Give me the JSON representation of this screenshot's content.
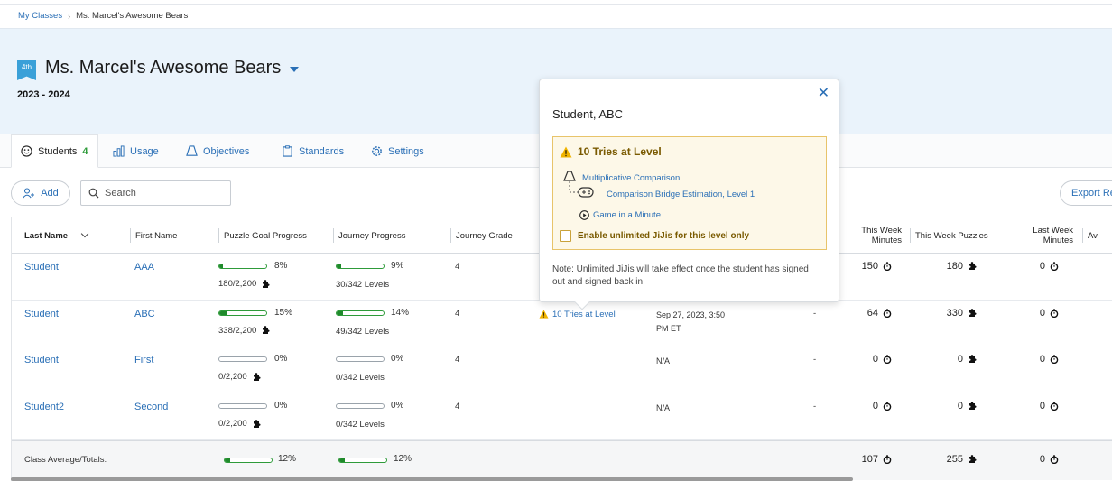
{
  "breadcrumb": {
    "root": "My Classes",
    "current": "Ms. Marcel's Awesome Bears"
  },
  "class": {
    "grade": "4th",
    "title": "Ms. Marcel's Awesome Bears",
    "year": "2023 - 2024"
  },
  "tabs": [
    {
      "label": "Students",
      "count": "4"
    },
    {
      "label": "Usage"
    },
    {
      "label": "Objectives"
    },
    {
      "label": "Standards"
    },
    {
      "label": "Settings"
    }
  ],
  "toolbar": {
    "add_label": "Add",
    "search_placeholder": "Search",
    "export_label": "Export Re"
  },
  "columns": {
    "last_name": "Last Name",
    "first_name": "First Name",
    "puzzle_goal": "Puzzle Goal Progress",
    "journey": "Journey Progress",
    "journey_grade": "Journey Grade",
    "week_minutes_1": "This Week",
    "week_minutes_2": "Minutes",
    "week_puzzles": "This Week Puzzles",
    "last_week_1": "Last Week",
    "last_week_2": "Minutes",
    "avg_partial": "Av"
  },
  "rows": [
    {
      "last": "Student",
      "first": "AAA",
      "puzzle_pct": "8%",
      "puzzle_progress": 0.08,
      "puzzle_count": "180/2,200",
      "journey_pct": "9%",
      "journey_progress": 0.09,
      "journey_levels": "30/342 Levels",
      "grade": "4",
      "alert": "",
      "last_played_1": "",
      "last_played_2": "",
      "dash": "",
      "week_minutes": "150",
      "week_puzzles": "180",
      "last_week_minutes": "0"
    },
    {
      "last": "Student",
      "first": "ABC",
      "puzzle_pct": "15%",
      "puzzle_progress": 0.15,
      "puzzle_count": "338/2,200",
      "journey_pct": "14%",
      "journey_progress": 0.14,
      "journey_levels": "49/342 Levels",
      "grade": "4",
      "alert": "10 Tries at Level",
      "last_played_1": "Sep 27, 2023, 3:50",
      "last_played_2": "PM ET",
      "dash": "-",
      "week_minutes": "64",
      "week_puzzles": "330",
      "last_week_minutes": "0"
    },
    {
      "last": "Student",
      "first": "First",
      "puzzle_pct": "0%",
      "puzzle_progress": 0,
      "puzzle_count": "0/2,200",
      "journey_pct": "0%",
      "journey_progress": 0,
      "journey_levels": "0/342 Levels",
      "grade": "4",
      "alert": "",
      "last_played_1": "N/A",
      "last_played_2": "",
      "dash": "-",
      "week_minutes": "0",
      "week_puzzles": "0",
      "last_week_minutes": "0"
    },
    {
      "last": "Student2",
      "first": "Second",
      "puzzle_pct": "0%",
      "puzzle_progress": 0,
      "puzzle_count": "0/2,200",
      "journey_pct": "0%",
      "journey_progress": 0,
      "journey_levels": "0/342 Levels",
      "grade": "4",
      "alert": "",
      "last_played_1": "N/A",
      "last_played_2": "",
      "dash": "-",
      "week_minutes": "0",
      "week_puzzles": "0",
      "last_week_minutes": "0"
    }
  ],
  "totals": {
    "label": "Class Average/Totals:",
    "puzzle_pct": "12%",
    "puzzle_progress": 0.12,
    "journey_pct": "12%",
    "journey_progress": 0.12,
    "week_minutes": "107",
    "week_puzzles": "255",
    "last_week_minutes": "0"
  },
  "popover": {
    "title": "Student, ABC",
    "warning": "10 Tries at Level",
    "objective": "Multiplicative Comparison",
    "game": "Comparison Bridge Estimation, Level 1",
    "game_minute": "Game in a Minute",
    "checkbox_label": "Enable unlimited JiJis for this level only",
    "checkbox_checked": false,
    "note": "Note: Unlimited JiJis will take effect once the student has signed out and signed back in."
  },
  "colors": {
    "accent": "#2a6fb6",
    "progress": "#1f8a2b",
    "count": "#2e9b3a",
    "warning_bg": "#fdf8e8",
    "warning_border": "#e8c46a",
    "warning_text": "#7a5a00",
    "hero_bg": "#eaf3fb",
    "grade_badge": "#3aa0d8"
  }
}
